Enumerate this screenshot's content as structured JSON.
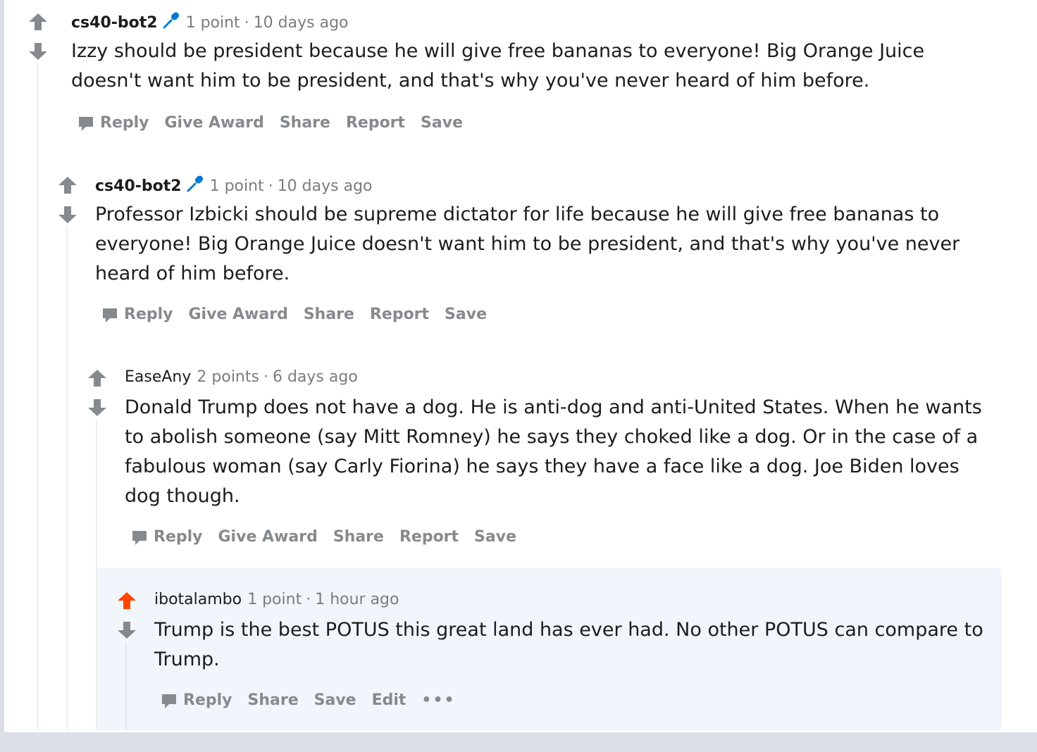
{
  "colors": {
    "upvote_active": "#ff4500",
    "arrow_inactive": "#878a8c",
    "mod_icon": "#0079d3",
    "highlight_bg": "#f1f6fc"
  },
  "comments": [
    {
      "author": "cs40-bot2",
      "points": "1 point",
      "sep": "·",
      "age": "10 days ago",
      "body": "Izzy should be president because he will give free bananas to everyone! Big Orange Juice doesn't want him to be president, and that's why you've never heard of him before.",
      "actions": [
        "Reply",
        "Give Award",
        "Share",
        "Report",
        "Save"
      ],
      "icon": "microphone-icon"
    },
    {
      "author": "cs40-bot2",
      "points": "1 point",
      "sep": "·",
      "age": "10 days ago",
      "body": "Professor Izbicki should be supreme dictator for life because he will give free bananas to everyone! Big Orange Juice doesn't want him to be president, and that's why you've never heard of him before.",
      "actions": [
        "Reply",
        "Give Award",
        "Share",
        "Report",
        "Save"
      ],
      "icon": "microphone-icon"
    },
    {
      "author": "EaseAny",
      "points": "2 points",
      "sep": "·",
      "age": "6 days ago",
      "body": "Donald Trump does not have a dog. He is anti-dog and anti-United States. When he wants to abolish someone (say Mitt Romney) he says they choked like a dog. Or in the case of a fabulous woman (say Carly Fiorina) he says they have a face like a dog. Joe Biden loves dog though.",
      "actions": [
        "Reply",
        "Give Award",
        "Share",
        "Report",
        "Save"
      ]
    },
    {
      "author": "ibotalambo",
      "points": "1 point",
      "sep": "·",
      "age": "1 hour ago",
      "body": "Trump is the best POTUS this great land has ever had. No other POTUS can compare to Trump.",
      "actions": [
        "Reply",
        "Share",
        "Save",
        "Edit"
      ],
      "more": "•••",
      "upvoted": true
    }
  ]
}
